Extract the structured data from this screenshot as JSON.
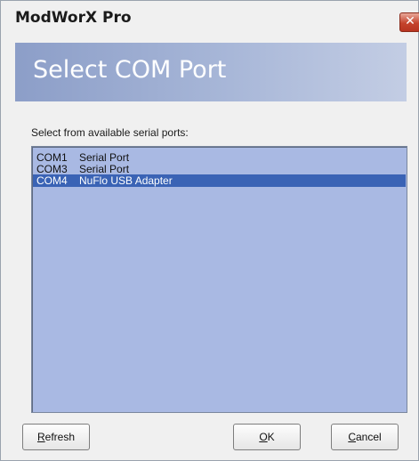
{
  "window": {
    "title": "ModWorX Pro",
    "close_glyph": "✕"
  },
  "header": {
    "title": "Select COM Port"
  },
  "prompt": "Select from available serial ports:",
  "ports": [
    {
      "port": "COM1",
      "description": "Serial Port",
      "selected": false
    },
    {
      "port": "COM3",
      "description": "Serial Port",
      "selected": false
    },
    {
      "port": "COM4",
      "description": "NuFlo USB Adapter",
      "selected": true
    }
  ],
  "buttons": {
    "refresh": {
      "mnemonic": "R",
      "rest": "efresh"
    },
    "ok": {
      "mnemonic": "O",
      "rest": "K"
    },
    "cancel": {
      "mnemonic": "C",
      "rest": "ancel"
    }
  },
  "colors": {
    "header_gradient_start": "#8c9ec8",
    "list_background": "#a9b9e3",
    "selection": "#3a63b5",
    "close_button": "#c4432d"
  }
}
